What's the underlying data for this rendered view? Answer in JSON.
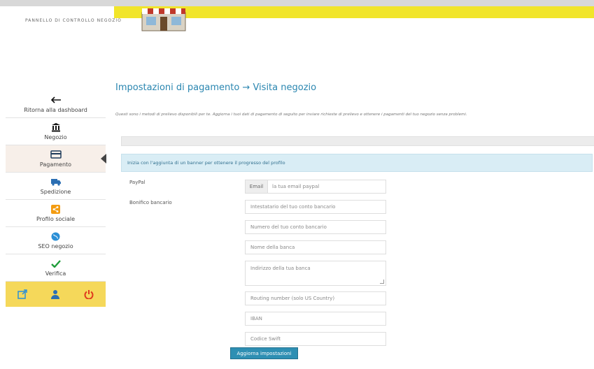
{
  "brand": "PANNELLO DI CONTROLLO NEGOZIO",
  "sidebar": {
    "items": [
      {
        "label": "Ritorna alla dashboard",
        "icon": "back-arrow-icon"
      },
      {
        "label": "Negozio",
        "icon": "bank-icon"
      },
      {
        "label": "Pagamento",
        "icon": "credit-card-icon",
        "active": true
      },
      {
        "label": "Spedizione",
        "icon": "truck-icon"
      },
      {
        "label": "Profilo sociale",
        "icon": "share-icon"
      },
      {
        "label": "SEO negozio",
        "icon": "globe-icon"
      },
      {
        "label": "Verifica",
        "icon": "check-icon"
      }
    ],
    "bottom_icons": [
      "external-link-icon",
      "user-icon",
      "power-icon"
    ]
  },
  "main": {
    "title": "Impostazioni di pagamento → Visita negozio",
    "description": "Questi sono i metodi di prelievo disponibili per te. Aggiorna i tuoi dati di pagamento di seguito per inviare richieste di prelievo e ottenere i pagamenti del tuo negozio senza problemi.",
    "notice": "Inizia con l'aggiunta di un banner per ottenere il progresso del profilo"
  },
  "form": {
    "paypal_label": "PayPal",
    "email_addon": "Email",
    "email_placeholder": "la tua email paypal",
    "bank_label": "Bonifico bancario",
    "account_holder_placeholder": "Intestatario del tuo conto bancario",
    "account_number_placeholder": "Numero del tuo conto bancario",
    "bank_name_placeholder": "Nome della banca",
    "bank_address_placeholder": "Indirizzo della tua banca",
    "routing_placeholder": "Routing number (solo US Country)",
    "iban_placeholder": "IBAN",
    "swift_placeholder": "Codice Swift",
    "save_label": "Aggiorna impostazioni"
  },
  "colors": {
    "yellow": "#f1e52a",
    "accent": "#2a86b0",
    "notice_bg": "#d9edf5",
    "sidebar_bottom": "#f5d85a"
  }
}
